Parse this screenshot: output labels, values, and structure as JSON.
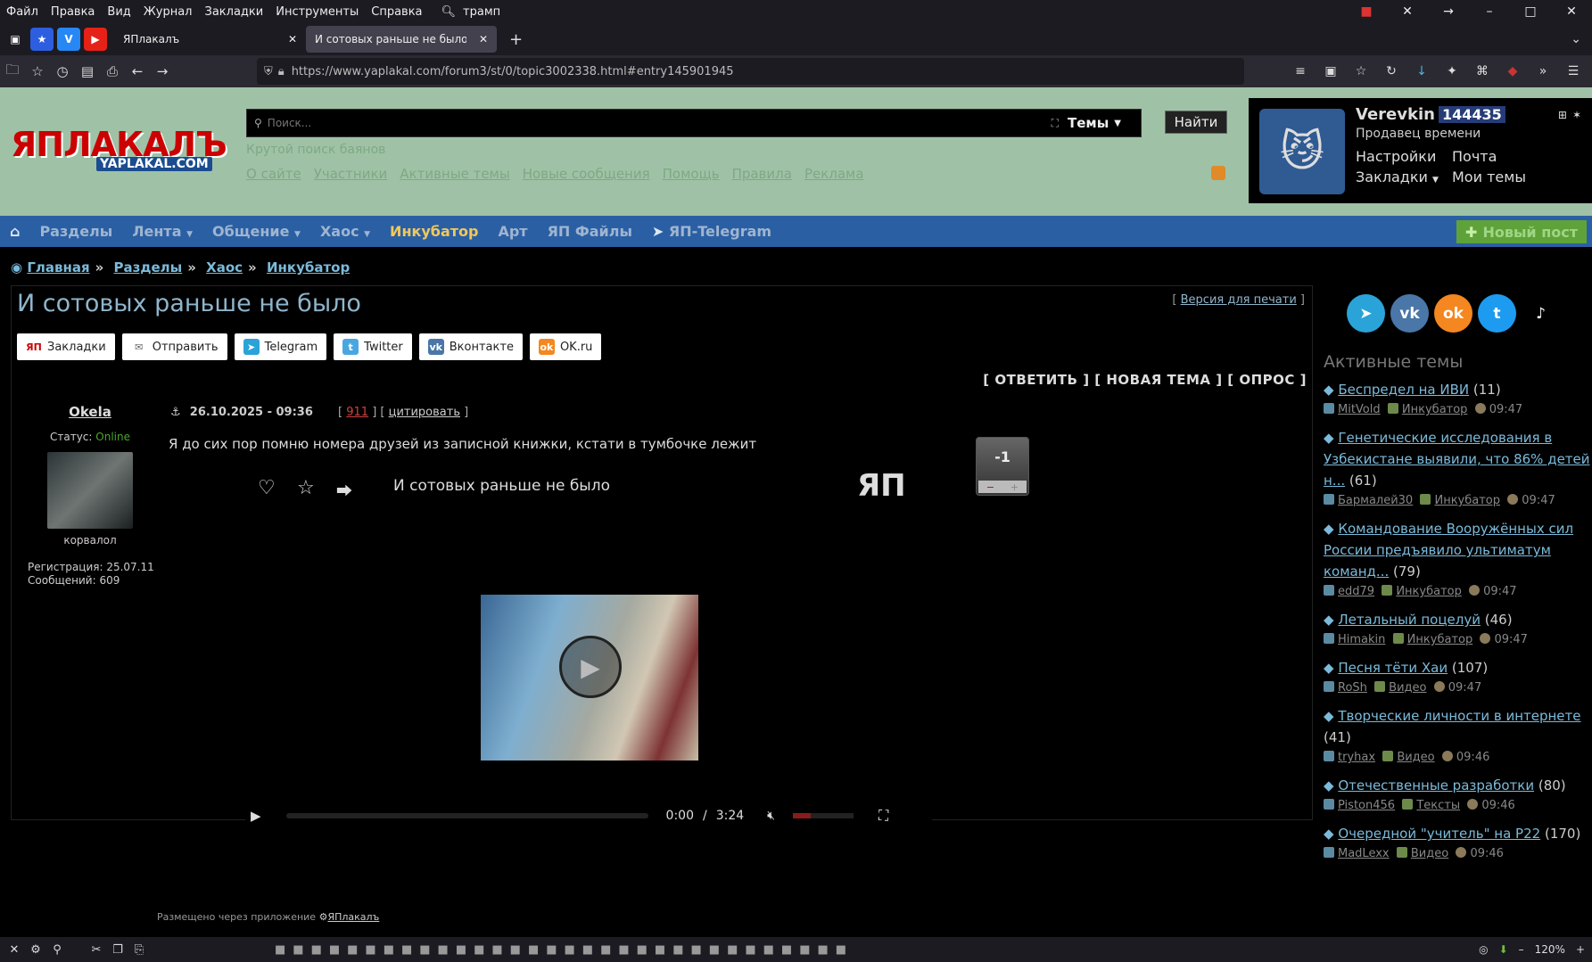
{
  "browser": {
    "menu": [
      "Файл",
      "Правка",
      "Вид",
      "Журнал",
      "Закладки",
      "Инструменты",
      "Справка"
    ],
    "search_text": "трамп",
    "tabs": [
      {
        "label": "ЯПлакалъ"
      },
      {
        "label": "И сотовых раньше не было - ЯП"
      }
    ],
    "url": "https://www.yaplakal.com/forum3/st/0/topic3002338.html#entry145901945"
  },
  "site": {
    "logo_text": "ЯПЛАКАЛЪ",
    "logo_sub": "YAPLAKAL.COM",
    "search_placeholder": "Поиск...",
    "search_scope": "Темы",
    "find_label": "Найти",
    "search_hint": "Крутой поиск баянов",
    "top_links": [
      "О сайте",
      "Участники",
      "Активные темы",
      "Новые сообщения",
      "Помощь",
      "Правила",
      "Реклама"
    ],
    "user": {
      "name": "Verevkin",
      "reputation": "144435",
      "title": "Продавец времени",
      "links": [
        "Настройки",
        "Почта",
        "Закладки",
        "Мои темы"
      ]
    },
    "nav": [
      "Разделы",
      "Лента",
      "Общение",
      "Хаос",
      "Инкубатор",
      "Арт",
      "ЯП Файлы",
      "ЯП-Telegram"
    ],
    "new_post": "Новый пост"
  },
  "breadcrumbs": [
    "Главная",
    "Разделы",
    "Хаос",
    "Инкубатор"
  ],
  "topic": {
    "title": "И сотовых раньше не было",
    "print_version": "Версия для печати",
    "share_buttons": [
      "Закладки",
      "Отправить",
      "Telegram",
      "Twitter",
      "Вконтакте",
      "OK.ru"
    ],
    "actions": "[ ОТВЕТИТЬ ] [ НОВАЯ ТЕМА ] [ ОПРОС ]"
  },
  "post": {
    "author": "Okela",
    "status_label": "Статус:",
    "status": "Online",
    "avatar_caption": "корвалол",
    "registration": "Регистрация: 25.07.11",
    "messages": "Сообщений: 609",
    "datetime": "26.10.2025 - 09:36",
    "number": "911",
    "quote_label": "цитировать",
    "text": "Я до сих пор помню номера друзей из записной книжки, кстати в тумбочке лежит",
    "vote": "-1",
    "posted_via": "Размещено через приложение",
    "app_name": "ЯПлакалъ",
    "video": {
      "title": "И сотовых раньше не было",
      "current": "0:00",
      "duration": "3:24",
      "progress": 0,
      "volume": 0.3
    }
  },
  "sidebar": {
    "heading": "Активные темы",
    "topics": [
      {
        "title": "Беспредел на ИВИ",
        "count": "(11)",
        "user": "MitVold",
        "section": "Инкубатор",
        "time": "09:47"
      },
      {
        "title": "Генетические исследования в Узбекистане выявили, что 86% детей н...",
        "count": "(61)",
        "user": "Бармалей30",
        "section": "Инкубатор",
        "time": "09:47"
      },
      {
        "title": "Командование Вооружённых сил России предъявило ультиматум команд...",
        "count": "(79)",
        "user": "edd79",
        "section": "Инкубатор",
        "time": "09:47"
      },
      {
        "title": "Летальный поцелуй",
        "count": "(46)",
        "user": "Himakin",
        "section": "Инкубатор",
        "time": "09:47"
      },
      {
        "title": "Песня тёти Хаи",
        "count": "(107)",
        "user": "RoSh",
        "section": "Видео",
        "time": "09:47"
      },
      {
        "title": "Творческие личности в интернете",
        "count": "(41)",
        "user": "tryhax",
        "section": "Видео",
        "time": "09:46"
      },
      {
        "title": "Отечественные разработки",
        "count": "(80)",
        "user": "Piston456",
        "section": "Тексты",
        "time": "09:46"
      },
      {
        "title": "Очередной \"учитель\" на Р22",
        "count": "(170)",
        "user": "MadLexx",
        "section": "Видео",
        "time": "09:46"
      }
    ]
  },
  "taskbar": {
    "zoom": "120%"
  },
  "colors": {
    "header_bg": "#9fc2a6",
    "nav_bg": "#2b5fa4",
    "link": "#7bbada"
  }
}
